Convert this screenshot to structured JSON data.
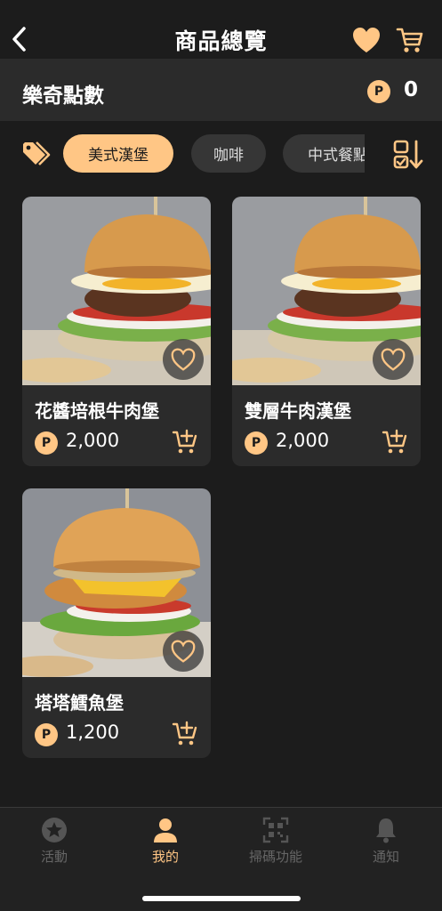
{
  "header": {
    "title": "商品總覽",
    "back_icon": "chevron-left-icon",
    "favorites_icon": "heart-icon",
    "cart_icon": "cart-icon"
  },
  "points": {
    "label": "樂奇點數",
    "coin_symbol": "P",
    "value": "0"
  },
  "categories": {
    "tag_icon": "tag-icon",
    "items": [
      {
        "label": "美式漢堡",
        "active": true
      },
      {
        "label": "咖啡",
        "active": false
      },
      {
        "label": "中式餐點",
        "active": false
      }
    ],
    "sort_icon": "sort-icon"
  },
  "products": [
    {
      "name": "花醬培根牛肉堡",
      "coin_symbol": "P",
      "price": "2,000",
      "favorited": false
    },
    {
      "name": "雙層牛肉漢堡",
      "coin_symbol": "P",
      "price": "2,000",
      "favorited": false
    },
    {
      "name": "塔塔鱈魚堡",
      "coin_symbol": "P",
      "price": "1,200",
      "favorited": false
    }
  ],
  "nav": [
    {
      "label": "活動",
      "icon": "star-icon",
      "active": false
    },
    {
      "label": "我的",
      "icon": "person-icon",
      "active": true
    },
    {
      "label": "掃碼功能",
      "icon": "qr-code-icon",
      "active": false
    },
    {
      "label": "通知",
      "icon": "bell-icon",
      "active": false
    }
  ],
  "colors": {
    "accent": "#ffc685",
    "background": "#1c1c1c",
    "card": "#2b2b2b"
  }
}
